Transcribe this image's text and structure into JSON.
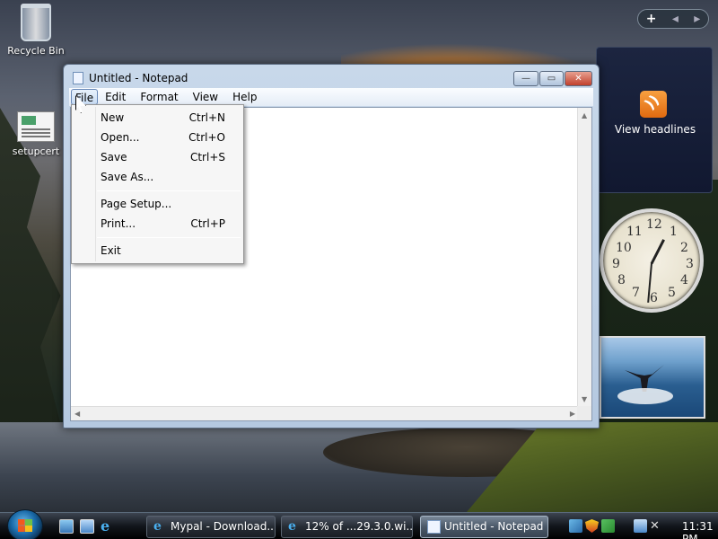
{
  "desktop": {
    "icons": [
      {
        "label": "Recycle Bin",
        "icon": "recycle-bin-icon"
      },
      {
        "label": "setupcert",
        "icon": "document-icon"
      }
    ]
  },
  "gadgets": {
    "toolbar": {
      "add": "+",
      "prev": "◂",
      "next": "▸"
    },
    "feed": {
      "label": "View headlines",
      "icon": "rss-icon"
    },
    "clock": {
      "numbers": [
        "12",
        "1",
        "2",
        "3",
        "4",
        "5",
        "6",
        "7",
        "8",
        "9",
        "10",
        "11"
      ],
      "time": "11:31"
    },
    "slideshow": {
      "subject": "whale-tail-photo"
    }
  },
  "notepad": {
    "title": "Untitled - Notepad",
    "controls": {
      "minimize": "—",
      "maximize": "▭",
      "close": "✕"
    },
    "menu": [
      "File",
      "Edit",
      "Format",
      "View",
      "Help"
    ],
    "file_menu": {
      "groups": [
        [
          {
            "label": "New",
            "shortcut": "Ctrl+N"
          },
          {
            "label": "Open...",
            "shortcut": "Ctrl+O"
          },
          {
            "label": "Save",
            "shortcut": "Ctrl+S"
          },
          {
            "label": "Save As...",
            "shortcut": ""
          }
        ],
        [
          {
            "label": "Page Setup...",
            "shortcut": ""
          },
          {
            "label": "Print...",
            "shortcut": "Ctrl+P"
          }
        ],
        [
          {
            "label": "Exit",
            "shortcut": ""
          }
        ]
      ]
    },
    "scroll_arrows": {
      "up": "▲",
      "down": "▼",
      "left": "◀",
      "right": "▶"
    }
  },
  "taskbar": {
    "tasks": [
      {
        "label": "Mypal - Download...",
        "icon": "ie-icon",
        "active": false
      },
      {
        "label": "12% of ...29.3.0.wi...",
        "icon": "ie-icon",
        "active": false
      },
      {
        "label": "Untitled - Notepad",
        "icon": "notepad-icon",
        "active": true
      }
    ],
    "clock": "11:31 PM",
    "ie_glyph": "e",
    "volume_glyph": "✕"
  }
}
